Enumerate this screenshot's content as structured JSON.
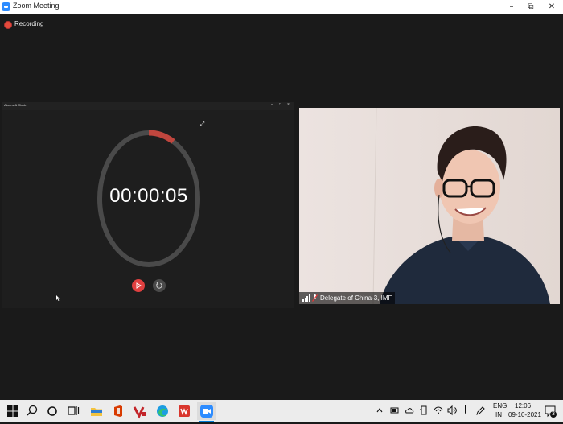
{
  "window": {
    "title": "Zoom Meeting"
  },
  "recording": {
    "label": "Recording"
  },
  "shared_app": {
    "title": "Alarms & Clock",
    "timer": "00:00:05",
    "progress_fraction": 0.083
  },
  "participant": {
    "name": "Delegate of China-3, IMF"
  },
  "taskbar": {
    "language_line1": "ENG",
    "language_line2": "IN",
    "time": "12:06",
    "date": "09-10-2021",
    "notification_count": "3"
  },
  "colors": {
    "accent": "#2d8cff",
    "record": "#e44b3c",
    "ring": "#4a4a4a",
    "ring_progress": "#c0463e"
  }
}
